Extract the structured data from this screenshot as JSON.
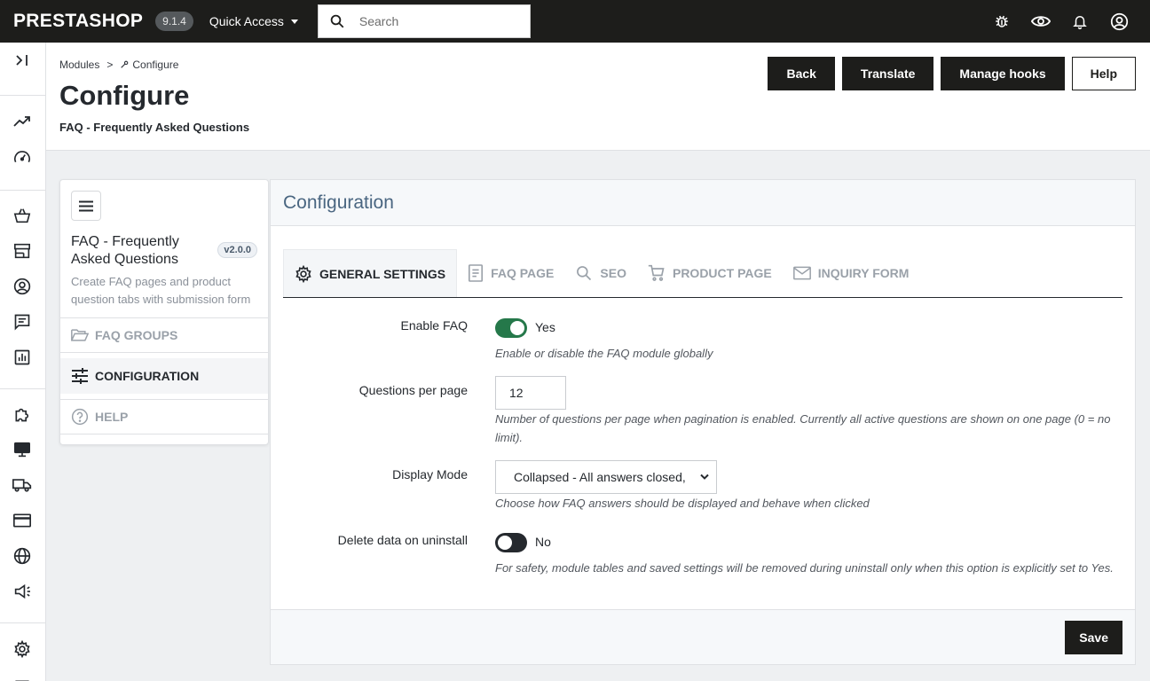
{
  "topbar": {
    "logo": "PRESTASHOP",
    "version": "9.1.4",
    "quick_access": "Quick Access",
    "search_placeholder": "Search"
  },
  "breadcrumb": {
    "parent": "Modules",
    "separator": ">",
    "current": "Configure"
  },
  "header": {
    "title": "Configure",
    "subtitle": "FAQ - Frequently Asked Questions",
    "buttons": {
      "back": "Back",
      "translate": "Translate",
      "manage_hooks": "Manage hooks",
      "help": "Help"
    }
  },
  "sidepanel": {
    "title": "FAQ - Frequently Asked Questions",
    "version": "v2.0.0",
    "description": "Create FAQ pages and product question tabs with submission form",
    "items": [
      {
        "label": "FAQ GROUPS",
        "icon": "folder-open-icon"
      },
      {
        "label": "CONFIGURATION",
        "icon": "tune-icon"
      },
      {
        "label": "HELP",
        "icon": "help-circle-icon"
      }
    ]
  },
  "card": {
    "title": "Configuration",
    "tabs": [
      {
        "label": "GENERAL SETTINGS",
        "icon": "gear-icon"
      },
      {
        "label": "FAQ PAGE",
        "icon": "page-icon"
      },
      {
        "label": "SEO",
        "icon": "search-icon"
      },
      {
        "label": "PRODUCT PAGE",
        "icon": "cart-icon"
      },
      {
        "label": "INQUIRY FORM",
        "icon": "mail-icon"
      }
    ],
    "fields": {
      "enable_faq": {
        "label": "Enable FAQ",
        "state": "Yes",
        "help": "Enable or disable the FAQ module globally"
      },
      "questions_per_page": {
        "label": "Questions per page",
        "value": "12",
        "help": "Number of questions per page when pagination is enabled. Currently all active questions are shown on one page (0 = no limit)."
      },
      "display_mode": {
        "label": "Display Mode",
        "value": "Collapsed - All answers closed,",
        "help": "Choose how FAQ answers should be displayed and behave when clicked"
      },
      "delete_data": {
        "label": "Delete data on uninstall",
        "state": "No",
        "help": "For safety, module tables and saved settings will be removed during uninstall only when this option is explicitly set to Yes."
      }
    },
    "save": "Save"
  },
  "colors": {
    "toggle_on": "#25784a",
    "dark": "#1d1d1b",
    "title_blue": "#4a6681"
  }
}
